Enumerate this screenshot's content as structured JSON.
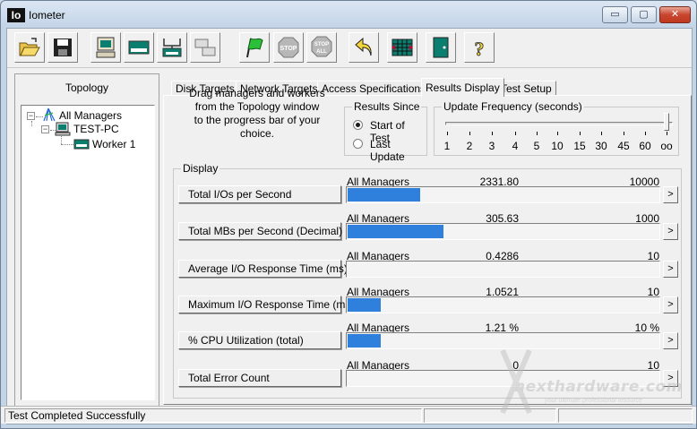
{
  "window": {
    "title": "Iometer",
    "app_icon_text": "Io",
    "min_glyph": "▭",
    "max_glyph": "▢",
    "close_glyph": "✕"
  },
  "toolbar": {
    "buttons": [
      {
        "name": "open-config",
        "icon": "folder-open-icon"
      },
      {
        "name": "save-config",
        "icon": "floppy-disk-icon"
      },
      {
        "name": "new-manager",
        "icon": "computer-icon"
      },
      {
        "name": "new-disk-worker",
        "icon": "disk-worker-icon"
      },
      {
        "name": "new-network-worker",
        "icon": "network-worker-icon"
      },
      {
        "name": "duplicate-worker",
        "icon": "duplicate-icon"
      },
      {
        "name": "start-tests",
        "icon": "green-flag-icon"
      },
      {
        "name": "stop-test",
        "icon": "stop-sign-icon",
        "label": "STOP"
      },
      {
        "name": "stop-all",
        "icon": "stop-all-icon",
        "label": "STOP",
        "sublabel": "ALL"
      },
      {
        "name": "reset-workers",
        "icon": "reset-arrow-icon"
      },
      {
        "name": "exit",
        "icon": "grid-exit-icon"
      },
      {
        "name": "exit-door",
        "icon": "door-icon"
      },
      {
        "name": "about",
        "icon": "question-icon",
        "label": "?"
      }
    ]
  },
  "topology": {
    "title": "Topology",
    "expander_glyph": "−",
    "nodes": [
      {
        "label": "All Managers"
      },
      {
        "label": "TEST-PC"
      },
      {
        "label": "Worker 1"
      }
    ]
  },
  "tabs": [
    {
      "label": "Disk Targets"
    },
    {
      "label": "Network Targets"
    },
    {
      "label": "Access Specifications"
    },
    {
      "label": "Results Display",
      "active": true
    },
    {
      "label": "Test Setup"
    }
  ],
  "results_display": {
    "instructions": [
      "Drag managers and workers",
      "from the Topology window",
      "to the progress bar of your choice."
    ],
    "results_since": {
      "title": "Results Since",
      "options": [
        {
          "label": "Start of Test",
          "selected": true
        },
        {
          "label": "Last Update",
          "selected": false
        }
      ]
    },
    "update_frequency": {
      "title": "Update Frequency (seconds)",
      "ticks": [
        "1",
        "2",
        "3",
        "4",
        "5",
        "10",
        "15",
        "30",
        "45",
        "60",
        "oo"
      ],
      "selected": "oo"
    },
    "display_title": "Display",
    "expand_glyph": ">",
    "rows": [
      {
        "button": "Total I/Os per Second",
        "manager": "All Managers",
        "value": "2331.80",
        "max": "10000",
        "fill_fraction": 0.233
      },
      {
        "button": "Total MBs per Second (Decimal)",
        "manager": "All Managers",
        "value": "305.63",
        "max": "1000",
        "fill_fraction": 0.306
      },
      {
        "button": "Average I/O Response Time (ms)",
        "manager": "All Managers",
        "value": "0.4286",
        "max": "10",
        "fill_fraction": 0.0
      },
      {
        "button": "Maximum I/O Response Time (ms)",
        "manager": "All Managers",
        "value": "1.0521",
        "max": "10",
        "fill_fraction": 0.105
      },
      {
        "button": "% CPU Utilization (total)",
        "manager": "All Managers",
        "value": "1.21 %",
        "max": "10 %",
        "fill_fraction": 0.105
      },
      {
        "button": "Total Error Count",
        "manager": "All Managers",
        "value": "0",
        "max": "10",
        "fill_fraction": 0.0
      }
    ]
  },
  "status": {
    "text": "Test Completed Successfully"
  },
  "watermark": {
    "brand": "nexthardware.com",
    "tagline": "your ultimate professional resource"
  },
  "colors": {
    "bar_fill": "#2f7fdc",
    "titlebar": "#c3d4e7"
  }
}
